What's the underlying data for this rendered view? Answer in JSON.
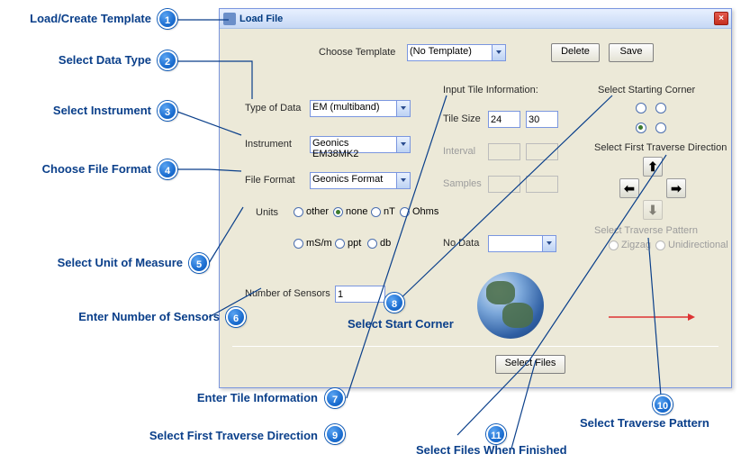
{
  "window": {
    "title": "Load File"
  },
  "template": {
    "label": "Choose Template",
    "selected": "(No Template)",
    "delete_btn": "Delete",
    "save_btn": "Save"
  },
  "type_of_data": {
    "label": "Type of Data",
    "selected": "EM (multiband)"
  },
  "instrument": {
    "label": "Instrument",
    "selected": "Geonics EM38MK2"
  },
  "file_format": {
    "label": "File Format",
    "selected": "Geonics Format"
  },
  "units_row": {
    "label": "Units",
    "options": {
      "other": "other",
      "none": "none",
      "nT": "nT",
      "ohms": "Ohms"
    },
    "selected": "none",
    "row2": {
      "mSm": "mS/m",
      "ppt": "ppt",
      "db": "db"
    }
  },
  "sensors": {
    "label": "Number of Sensors",
    "value": "1"
  },
  "tile": {
    "heading": "Input Tile Information:",
    "tile_size_label": "Tile Size",
    "tile_size_x": "24",
    "tile_size_y": "30",
    "interval_label": "Interval",
    "samples_label": "Samples",
    "nodata_label": "No Data"
  },
  "starting_corner_label": "Select Starting Corner",
  "traverse_dir_label": "Select First Traverse Direction",
  "traverse_pattern": {
    "label": "Select Traverse Pattern",
    "zigzag": "Zigzag",
    "uni": "Unidirectional"
  },
  "select_files_btn": "Select Files",
  "callouts": {
    "1": "Load/Create Template",
    "2": "Select Data Type",
    "3": "Select Instrument",
    "4": "Choose File Format",
    "5": "Select Unit of Measure",
    "6": "Enter Number of Sensors",
    "7": "Enter Tile Information",
    "8": "Select Start Corner",
    "9": "Select First Traverse Direction",
    "10": "Select Traverse Pattern",
    "11": "Select Files When Finished"
  }
}
